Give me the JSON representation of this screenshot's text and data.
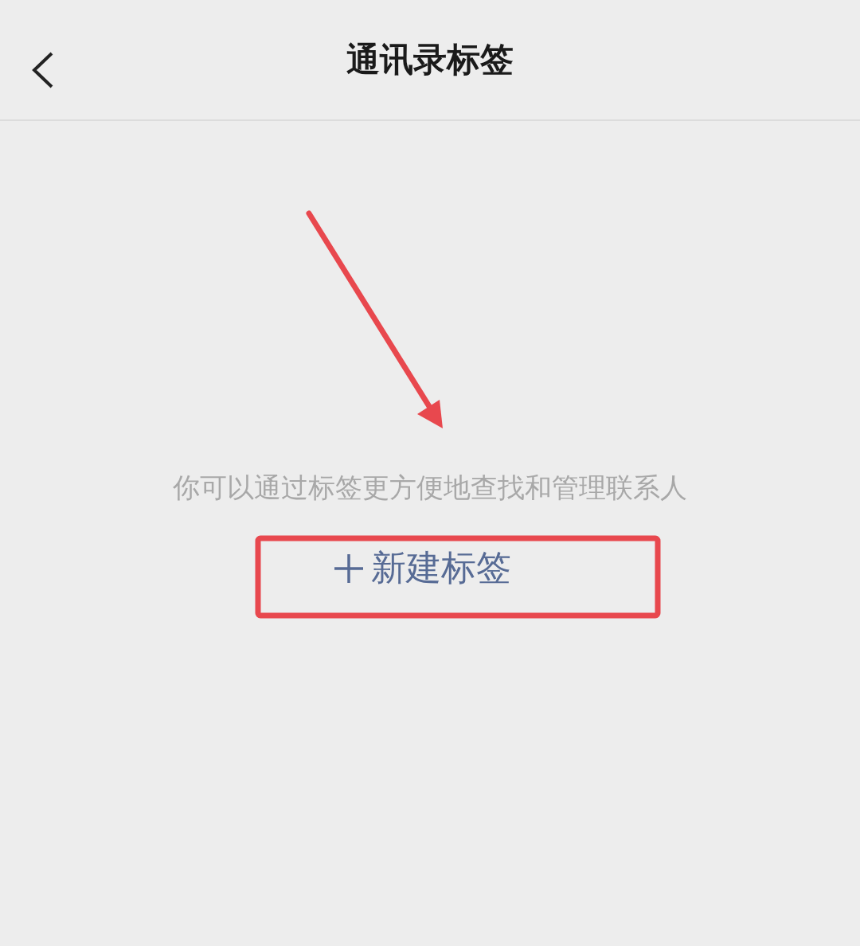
{
  "nav_bar": {
    "title": "通讯录标签"
  },
  "empty_state": {
    "hint": "你可以通过标签更方便地查找和管理联系人",
    "new_tag_button": {
      "label": "新建标签"
    }
  }
}
